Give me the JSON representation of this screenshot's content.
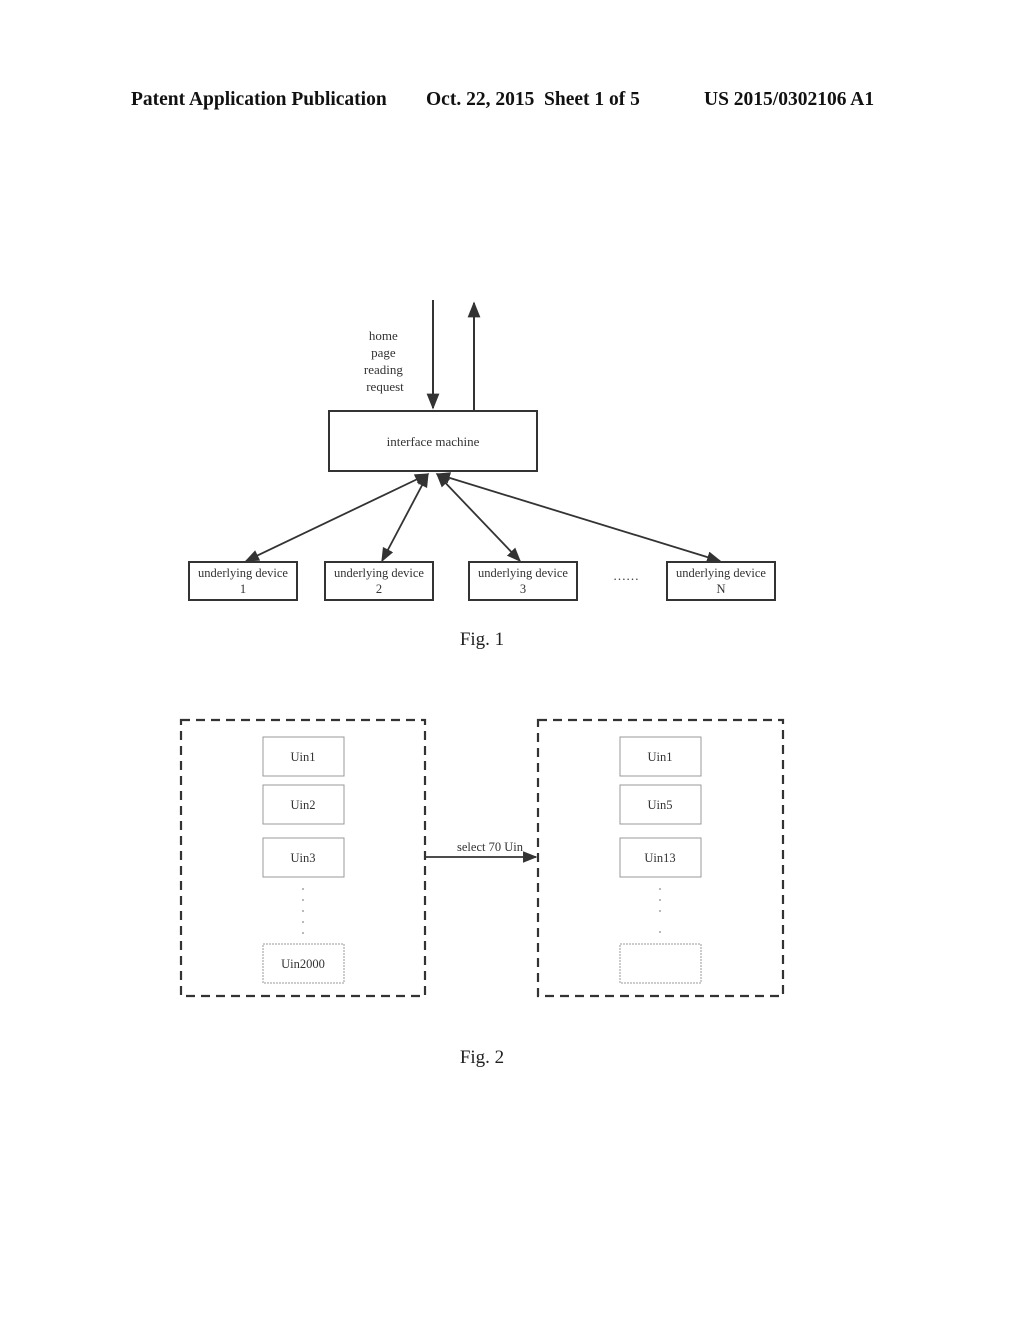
{
  "header": {
    "publication_type": "Patent Application Publication",
    "date": "Oct. 22, 2015",
    "sheet": "Sheet 1 of 5",
    "patent_number": "US 2015/0302106 A1"
  },
  "fig1": {
    "caption": "Fig. 1",
    "request_label_lines": [
      "home",
      "page",
      "reading",
      "request"
    ],
    "interface_machine_label": "interface machine",
    "devices": [
      {
        "line1": "underlying device",
        "line2": "1"
      },
      {
        "line1": "underlying device",
        "line2": "2"
      },
      {
        "line1": "underlying device",
        "line2": "3"
      },
      {
        "line1": "underlying device",
        "line2": "N"
      }
    ],
    "ellipsis": "……"
  },
  "fig2": {
    "caption": "Fig. 2",
    "left_items": [
      "Uin1",
      "Uin2",
      "Uin3",
      "Uin2000"
    ],
    "right_items": [
      "Uin1",
      "Uin5",
      "Uin13",
      ""
    ],
    "arrow_label": "select 70 Uin"
  }
}
